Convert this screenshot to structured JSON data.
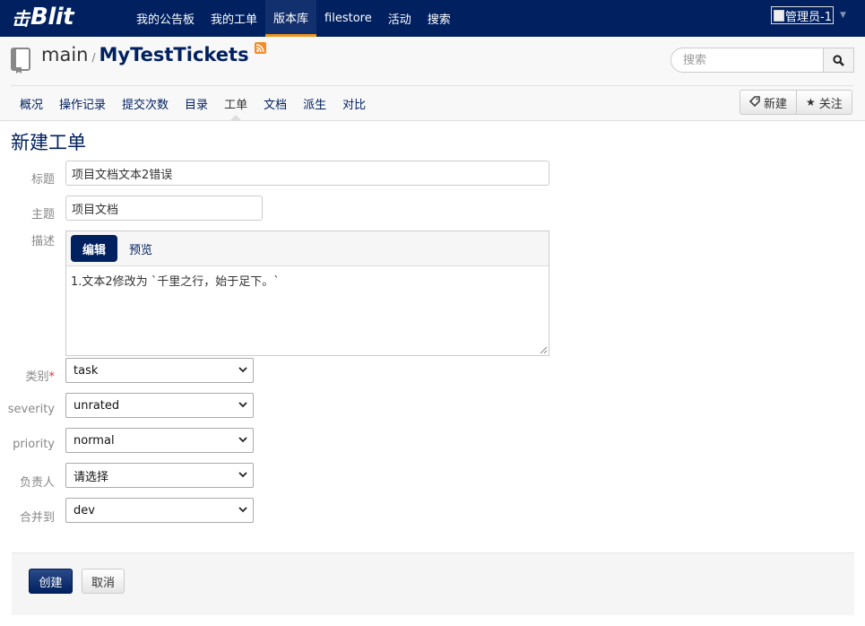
{
  "brand": {
    "logo_glyph": "击",
    "logo_word": "Blit"
  },
  "topnav": {
    "items": [
      {
        "label": "我的公告板",
        "active": false
      },
      {
        "label": "我的工单",
        "active": false
      },
      {
        "label": "版本库",
        "active": true
      },
      {
        "label": "filestore",
        "active": false
      },
      {
        "label": "活动",
        "active": false
      },
      {
        "label": "搜索",
        "active": false
      }
    ],
    "user_label": "管理员-1"
  },
  "repo": {
    "project": "main",
    "separator": "/",
    "name": "MyTestTickets",
    "search_placeholder": "搜索"
  },
  "subnav": {
    "items": [
      {
        "label": "概况",
        "active": false
      },
      {
        "label": "操作记录",
        "active": false
      },
      {
        "label": "提交次数",
        "active": false
      },
      {
        "label": "目录",
        "active": false
      },
      {
        "label": "工单",
        "active": true
      },
      {
        "label": "文档",
        "active": false
      },
      {
        "label": "派生",
        "active": false
      },
      {
        "label": "对比",
        "active": false
      }
    ],
    "new_label": "新建",
    "watch_label": "关注"
  },
  "form": {
    "title": "新建工单",
    "labels": {
      "title": "标题",
      "topic": "主题",
      "description": "描述",
      "type": "类别",
      "severity": "severity",
      "priority": "priority",
      "responsible": "负责人",
      "merge_to": "合并到"
    },
    "required_mark": "*",
    "values": {
      "title": "项目文档文本2错误",
      "topic": "项目文档",
      "description": "1.文本2修改为 `千里之行，始于足下。`",
      "type": "task",
      "severity": "unrated",
      "priority": "normal",
      "responsible": "请选择",
      "merge_to": "dev"
    },
    "tabs": {
      "edit": "编辑",
      "preview": "预览"
    },
    "create_label": "创建",
    "cancel_label": "取消"
  },
  "colors": {
    "brand": "#002060",
    "accent": "#f09420"
  }
}
